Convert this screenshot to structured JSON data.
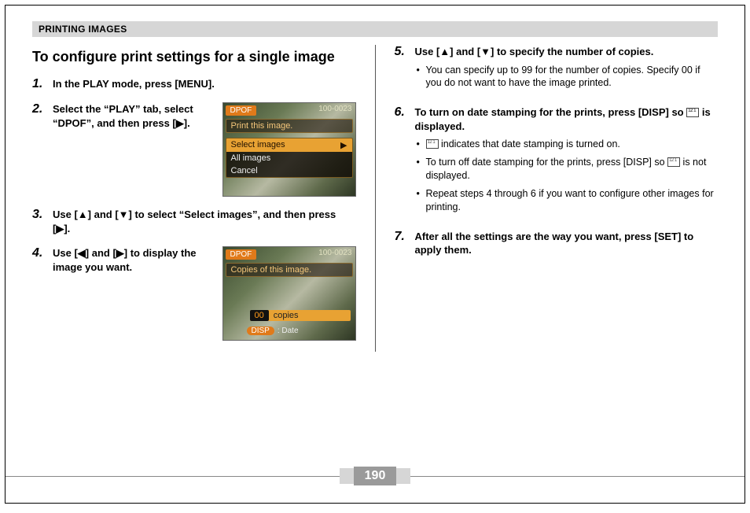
{
  "header": "PRINTING IMAGES",
  "section_title": "To configure print settings for a single image",
  "left_steps": [
    {
      "num": "1.",
      "text": "In the PLAY mode, press [MENU]."
    },
    {
      "num": "2.",
      "text": "Select the “PLAY” tab, select “DPOF”, and then press [▶]."
    },
    {
      "num": "3.",
      "text": "Use [▲] and [▼] to select “Select images”, and then press [▶]."
    },
    {
      "num": "4.",
      "text": "Use [◀] and [▶] to display the image you want."
    }
  ],
  "right_steps": [
    {
      "num": "5.",
      "text": "Use [▲] and [▼] to specify the number of copies.",
      "bullets": [
        "You can specify up to 99 for the number of copies. Specify 00 if you do not want to have the image printed."
      ]
    },
    {
      "num": "6.",
      "text": "To turn on date stamping for the prints, press [DISP] so {ICON} is displayed.",
      "bullets": [
        "{ICON} indicates that date stamping is turned on.",
        "To turn off date stamping for the prints, press [DISP] so {ICON} is not displayed.",
        "Repeat steps 4 through 6 if you want to configure other images for printing."
      ]
    },
    {
      "num": "7.",
      "text": "After all the settings are the way you want, press [SET] to apply them."
    }
  ],
  "lcd1": {
    "tab": "DPOF",
    "counter": "100-0023",
    "title": "Print this image.",
    "menu": [
      {
        "label": "Select images",
        "selected": true,
        "chevron": "▶"
      },
      {
        "label": "All images",
        "selected": false
      },
      {
        "label": "Cancel",
        "selected": false
      }
    ]
  },
  "lcd2": {
    "tab": "DPOF",
    "counter": "100-0023",
    "title": "Copies of this image.",
    "copies_value": "00",
    "copies_label": "copies",
    "disp_chip": "DISP",
    "disp_label": ": Date"
  },
  "page_number": "190"
}
